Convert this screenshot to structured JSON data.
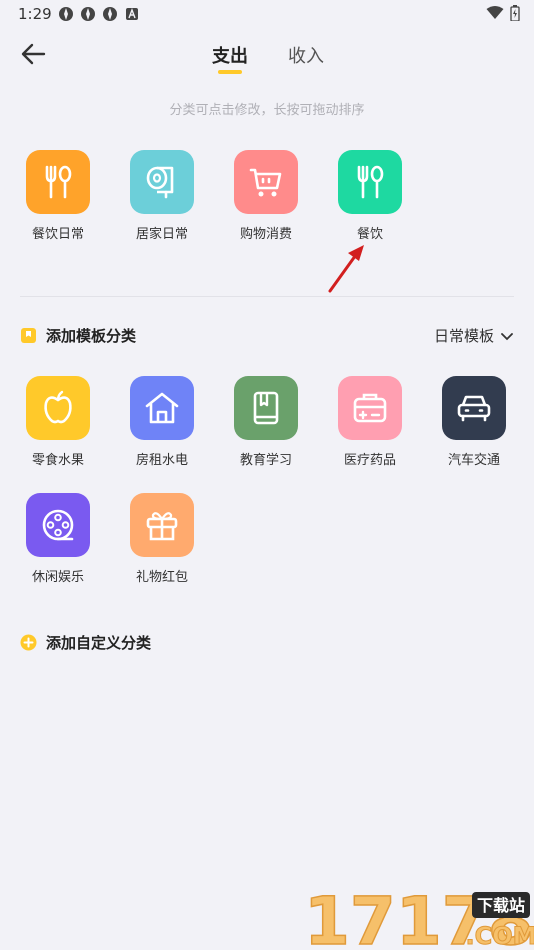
{
  "status_bar": {
    "time": "1:29"
  },
  "header": {
    "tabs": [
      {
        "label": "支出",
        "active": true
      },
      {
        "label": "收入",
        "active": false
      }
    ]
  },
  "hint": "分类可点击修改，长按可拖动排序",
  "my_categories": [
    {
      "label": "餐饮日常",
      "color": "#ffa32a",
      "icon": "fork-spoon-icon"
    },
    {
      "label": "居家日常",
      "color": "#6ccfd9",
      "icon": "tissue-roll-icon"
    },
    {
      "label": "购物消费",
      "color": "#ff8b8b",
      "icon": "shopping-cart-icon"
    },
    {
      "label": "餐饮",
      "color": "#1ed9a1",
      "icon": "fork-spoon-icon"
    }
  ],
  "template_section": {
    "title": "添加模板分类",
    "template_name": "日常模板",
    "items": [
      {
        "label": "零食水果",
        "color": "#ffc92a",
        "icon": "apple-icon"
      },
      {
        "label": "房租水电",
        "color": "#6f83f7",
        "icon": "house-icon"
      },
      {
        "label": "教育学习",
        "color": "#6aa16b",
        "icon": "book-icon"
      },
      {
        "label": "医疗药品",
        "color": "#ff9fb1",
        "icon": "medkit-icon"
      },
      {
        "label": "汽车交通",
        "color": "#323c4f",
        "icon": "car-icon"
      },
      {
        "label": "休闲娱乐",
        "color": "#7a5af0",
        "icon": "film-reel-icon"
      },
      {
        "label": "礼物红包",
        "color": "#ffaa6e",
        "icon": "gift-icon"
      }
    ]
  },
  "custom_section": {
    "title": "添加自定义分类"
  },
  "watermark": {
    "number": "17178",
    "badge": "下载站",
    "domain": ".COM"
  }
}
